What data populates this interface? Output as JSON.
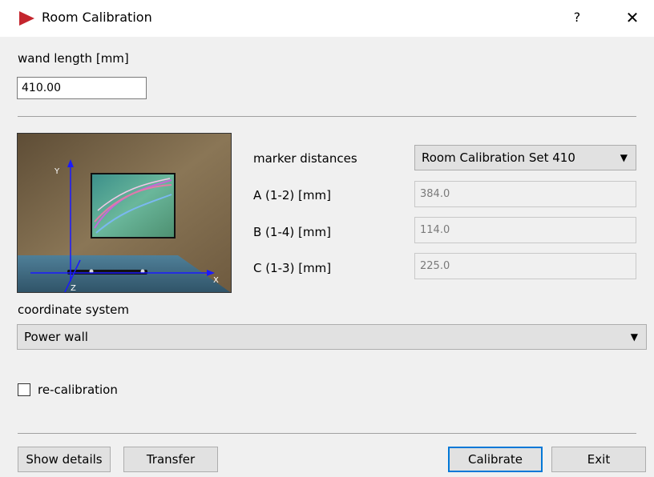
{
  "window": {
    "title": "Room Calibration",
    "help_label": "?",
    "close_label": "✕",
    "accent": "#c4262e"
  },
  "wand": {
    "label": "wand length [mm]",
    "value": "410.00"
  },
  "marker": {
    "label": "marker distances",
    "selected_set": "Room Calibration Set 410",
    "fields": [
      {
        "label": "A (1-2) [mm]",
        "value": "384.0"
      },
      {
        "label": "B (1-4) [mm]",
        "value": "114.0"
      },
      {
        "label": "C (1-3) [mm]",
        "value": "225.0"
      }
    ]
  },
  "image_axes": {
    "x": "X",
    "y": "Y",
    "z": "Z"
  },
  "coordinate": {
    "label": "coordinate system",
    "selected": "Power wall"
  },
  "recalibration": {
    "label": "re-calibration",
    "checked": false
  },
  "buttons": {
    "show_details": "Show details",
    "transfer": "Transfer",
    "calibrate": "Calibrate",
    "exit": "Exit"
  }
}
